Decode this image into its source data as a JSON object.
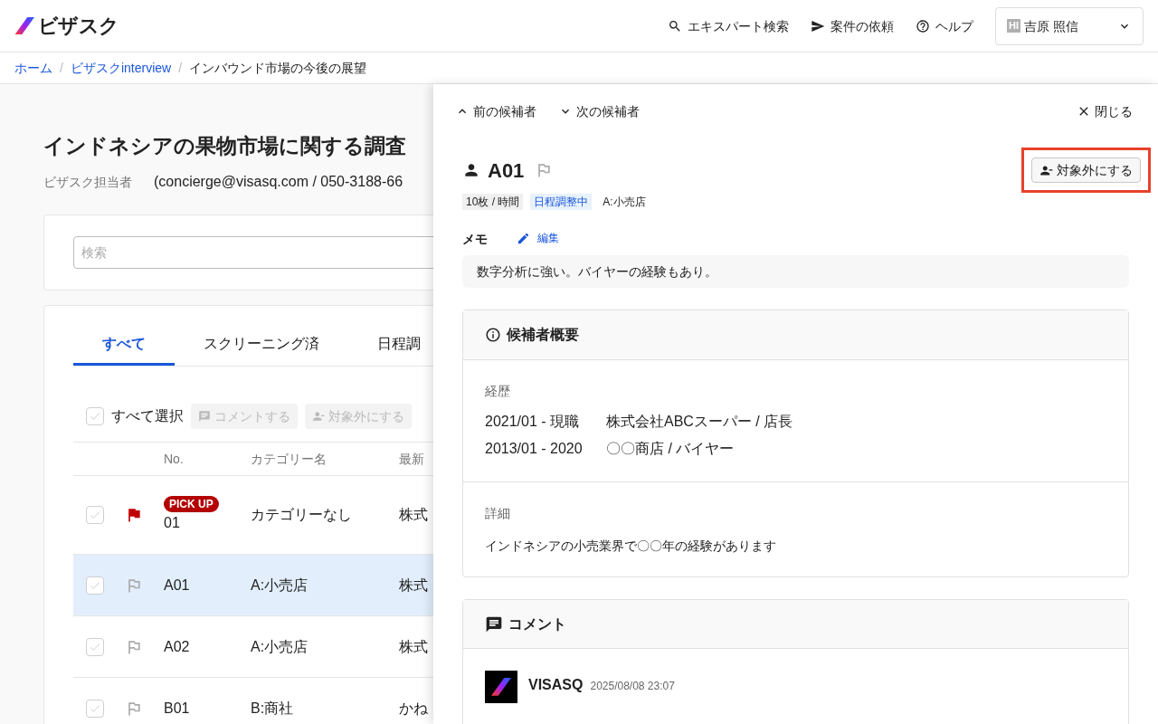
{
  "header": {
    "logo": "ビザスク",
    "nav": [
      {
        "kind": "search",
        "label": "エキスパート検索"
      },
      {
        "kind": "send",
        "label": "案件の依頼"
      },
      {
        "kind": "help",
        "label": "ヘルプ"
      }
    ],
    "user": {
      "initials": "HI",
      "name": "吉原 照信"
    }
  },
  "breadcrumbs": [
    {
      "label": "ホーム",
      "current": false
    },
    {
      "separator": "/",
      "label": "ビザスクinterview",
      "current": false
    },
    {
      "separator": "/",
      "label": "インバウンド市場の今後の展望",
      "current": true
    }
  ],
  "project": {
    "title": "インドネシアの果物市場に関する調査",
    "contact_label": "ビザスク担当者",
    "contact": "(concierge@visasq.com / 050-3188-66"
  },
  "search": {
    "placeholder": "検索"
  },
  "tabs": [
    {
      "label": "すべて",
      "selected": true
    },
    {
      "label": "スクリーニング済",
      "selected": false
    },
    {
      "label": "日程調",
      "selected": false
    }
  ],
  "bulk": {
    "select_all": {
      "label": "すべて選択",
      "checked": false
    },
    "actions": [
      {
        "kind": "comment",
        "label": "コメントする",
        "disabled": true
      },
      {
        "kind": "exclude",
        "label": "対象外にする",
        "disabled": true
      }
    ]
  },
  "table": {
    "columns": [
      "No.",
      "カテゴリー名",
      "最新"
    ],
    "rows": [
      {
        "checked": false,
        "flagged": true,
        "badge": "PICK UP",
        "no": "01",
        "category": "カテゴリーなし",
        "latest": "株式",
        "selected": false
      },
      {
        "checked": false,
        "flagged": false,
        "no": "A01",
        "category": "A:小売店",
        "latest": "株式",
        "selected": true
      },
      {
        "checked": false,
        "flagged": false,
        "no": "A02",
        "category": "A:小売店",
        "latest": "株式",
        "selected": false
      },
      {
        "checked": false,
        "flagged": false,
        "no": "B01",
        "category": "B:商社",
        "latest": "かね",
        "selected": false
      }
    ]
  },
  "drawer": {
    "prev": "前の候補者",
    "next": "次の候補者",
    "close": "閉じる",
    "candidate": {
      "name": "A01",
      "flagged": false
    },
    "exclude_button": {
      "label": "対象外にする",
      "highlighted": true
    },
    "tags": [
      {
        "kind": "gray",
        "label": "10枚 / 時間"
      },
      {
        "kind": "blue",
        "label": "日程調整中"
      },
      {
        "kind": "plain",
        "label": "A:小売店"
      }
    ],
    "memo": {
      "label": "メモ",
      "edit": "編集",
      "text": "数字分析に強い。バイヤーの経験もあり。"
    },
    "overview": {
      "title": "候補者概要",
      "career_label": "経歴",
      "career": [
        {
          "period": "2021/01 - 現職",
          "position": "株式会社ABCスーパー / 店長"
        },
        {
          "period": "2013/01 - 2020",
          "position": "〇〇商店 / バイヤー"
        }
      ],
      "detail_label": "詳細",
      "detail": "インドネシアの小売業界で〇〇年の経験があります"
    },
    "comments": {
      "title": "コメント",
      "items": [
        {
          "author": "VISASQ",
          "time": "2025/08/08 23:07"
        }
      ]
    }
  }
}
